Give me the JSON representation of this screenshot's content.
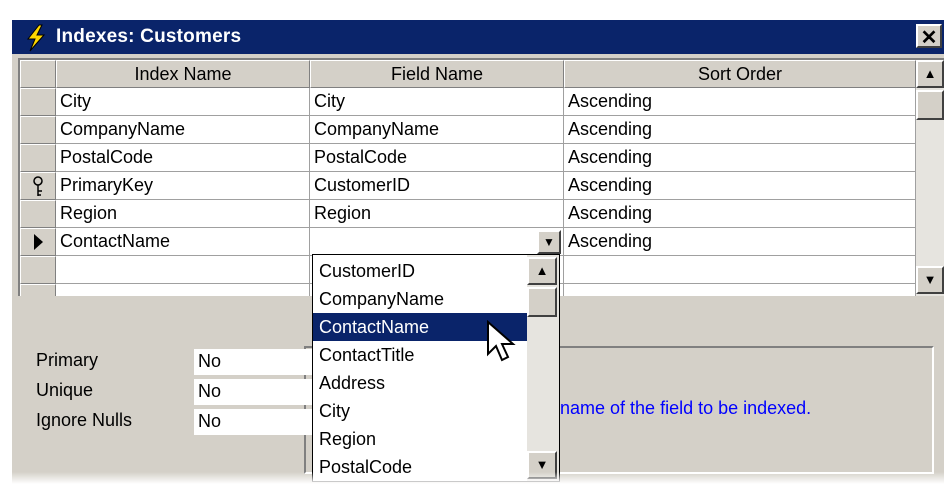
{
  "window": {
    "title": "Indexes: Customers",
    "close_glyph": "✕"
  },
  "grid": {
    "columns": [
      "Index Name",
      "Field Name",
      "Sort Order"
    ],
    "rows": [
      {
        "index": "City",
        "field": "City",
        "sort": "Ascending",
        "selector": ""
      },
      {
        "index": "CompanyName",
        "field": "CompanyName",
        "sort": "Ascending",
        "selector": ""
      },
      {
        "index": "PostalCode",
        "field": "PostalCode",
        "sort": "Ascending",
        "selector": ""
      },
      {
        "index": "PrimaryKey",
        "field": "CustomerID",
        "sort": "Ascending",
        "selector": "key-icon"
      },
      {
        "index": "Region",
        "field": "Region",
        "sort": "Ascending",
        "selector": ""
      },
      {
        "index": "ContactName",
        "field": "",
        "sort": "Ascending",
        "selector": "current-row-arrow-icon"
      },
      {
        "index": "",
        "field": "",
        "sort": "",
        "selector": ""
      }
    ]
  },
  "dropdown": {
    "items": [
      "CustomerID",
      "CompanyName",
      "ContactName",
      "ContactTitle",
      "Address",
      "City",
      "Region",
      "PostalCode"
    ],
    "highlighted": "ContactName"
  },
  "properties": {
    "primary_label": "Primary",
    "primary_value": "No",
    "unique_label": "Unique",
    "unique_value": "No",
    "ignore_nulls_label": "Ignore Nulls",
    "ignore_nulls_value": "No"
  },
  "help_text": "name of the field to be indexed.",
  "colors": {
    "titlebar": "#0a246a",
    "face": "#d4d0c8",
    "help_text": "#0000ff",
    "highlight": "#0a246a"
  }
}
